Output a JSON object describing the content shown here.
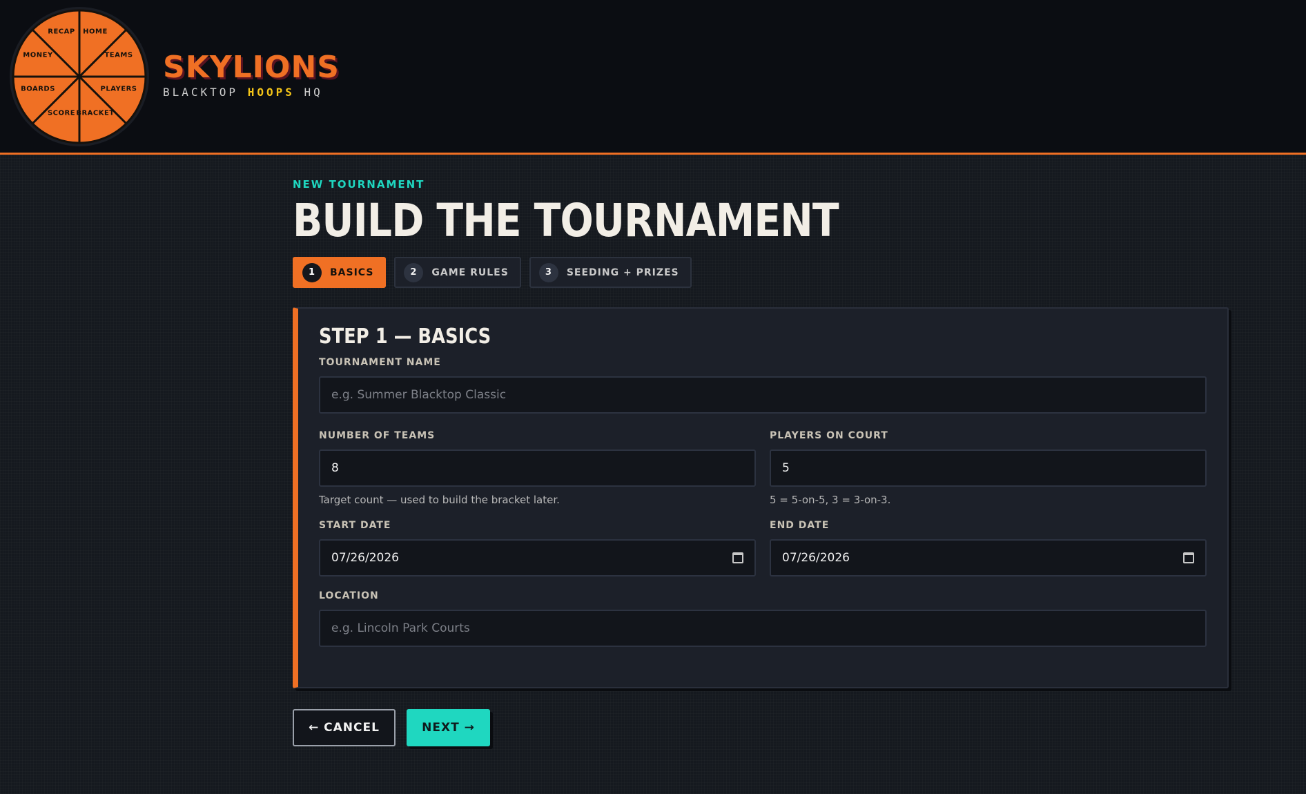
{
  "brand": {
    "name": "SKYLIONS",
    "tagline_pre": "BLACKTOP",
    "tagline_hl": "HOOPS",
    "tagline_post": "HQ"
  },
  "nav_wheel": {
    "items": [
      "RECAP",
      "HOME",
      "MONEY",
      "TEAMS",
      "BOARDS",
      "PLAYERS",
      "SCORE",
      "BRACKET"
    ]
  },
  "page": {
    "eyebrow": "NEW TOURNAMENT",
    "title": "BUILD THE TOURNAMENT"
  },
  "steps": [
    {
      "num": "1",
      "label": "BASICS",
      "active": true
    },
    {
      "num": "2",
      "label": "GAME RULES",
      "active": false
    },
    {
      "num": "3",
      "label": "SEEDING + PRIZES",
      "active": false
    }
  ],
  "form": {
    "title": "STEP 1 — BASICS",
    "tournament_name": {
      "label": "TOURNAMENT NAME",
      "value": "",
      "placeholder": "e.g. Summer Blacktop Classic"
    },
    "num_teams": {
      "label": "NUMBER OF TEAMS",
      "value": "8",
      "hint": "Target count — used to build the bracket later."
    },
    "players_on_court": {
      "label": "PLAYERS ON COURT",
      "value": "5",
      "hint": "5 = 5-on-5, 3 = 3-on-3."
    },
    "start_date": {
      "label": "START DATE",
      "value": "07/26/2026"
    },
    "end_date": {
      "label": "END DATE",
      "value": "07/26/2026"
    },
    "location": {
      "label": "LOCATION",
      "value": "",
      "placeholder": "e.g. Lincoln Park Courts"
    }
  },
  "actions": {
    "cancel": "← CANCEL",
    "next": "NEXT →"
  },
  "colors": {
    "accent": "#f07024",
    "teal": "#1fd7c0",
    "highlight": "#f5c518",
    "background": "#15191f",
    "header": "#0b0d12",
    "card": "#1c2029"
  }
}
